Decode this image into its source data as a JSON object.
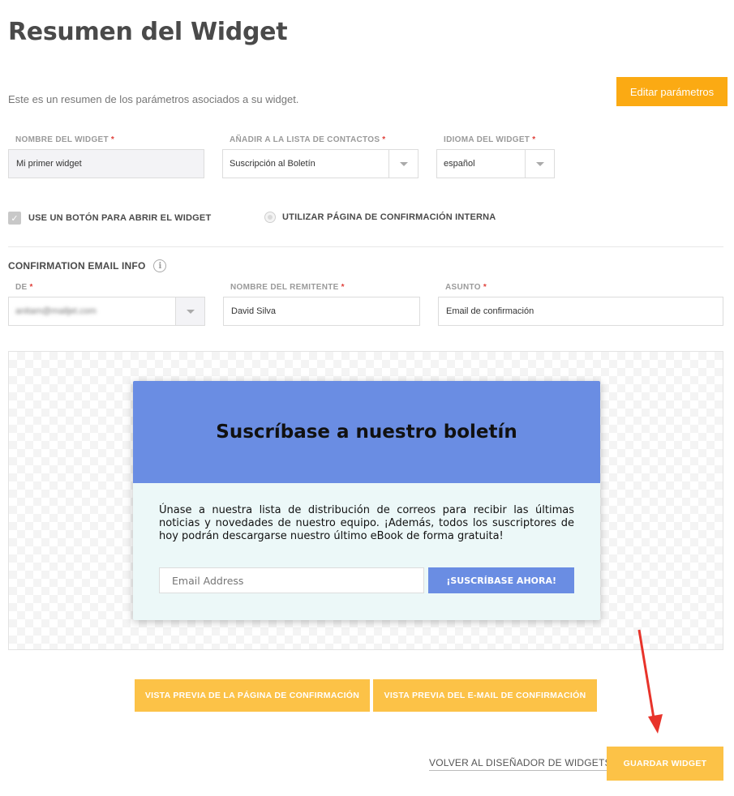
{
  "page": {
    "title": "Resumen del Widget",
    "intro": "Este es un resumen de los parámetros asociados a su widget.",
    "edit_button": "Editar parámetros"
  },
  "fields": {
    "widget_name": {
      "label": "NOMBRE DEL WIDGET",
      "value": "Mi primer widget"
    },
    "contact_list": {
      "label": "AÑADIR A LA LISTA DE CONTACTOS",
      "value": "Suscripción al Boletín"
    },
    "language": {
      "label": "IDIOMA DEL WIDGET",
      "value": "español"
    }
  },
  "required_mark": "*",
  "options": {
    "use_button": {
      "label": "USE UN BOTÓN PARA ABRIR EL WIDGET",
      "checked": true
    },
    "internal_confirmation": {
      "label": "UTILIZAR PÁGINA DE CONFIRMACIÓN INTERNA",
      "selected": false
    }
  },
  "confirmation_email": {
    "section_title": "CONFIRMATION EMAIL INFO",
    "from": {
      "label": "DE",
      "value": "anitam@mailjet.com"
    },
    "sender_name": {
      "label": "NOMBRE DEL REMITENTE",
      "value": "David Silva"
    },
    "subject": {
      "label": "ASUNTO",
      "value": "Email de confirmación"
    }
  },
  "widget_preview": {
    "title": "Suscríbase a nuestro boletín",
    "text": "Únase a nuestra lista de distribución de correos para recibir las últimas noticias y novedades de nuestro equipo. ¡Además, todos los suscriptores de hoy podrán descargarse nuestro último eBook de forma gratuita!",
    "email_placeholder": "Email Address",
    "subscribe_button": "¡SUSCRÍBASE AHORA!",
    "header_color": "#6a8de3",
    "body_color": "#ecf8f8"
  },
  "actions": {
    "preview_confirmation_page": "VISTA PREVIA DE LA PÁGINA DE CONFIRMACIÓN",
    "preview_confirmation_email": "VISTA PREVIA DEL E-MAIL DE CONFIRMACIÓN",
    "back_link": "VOLVER AL DISEÑADOR DE WIDGETS",
    "save_button": "GUARDAR WIDGET"
  },
  "colors": {
    "accent": "#fbaa13",
    "accent_light": "#fcc247",
    "annotation_arrow": "#e8332a"
  }
}
